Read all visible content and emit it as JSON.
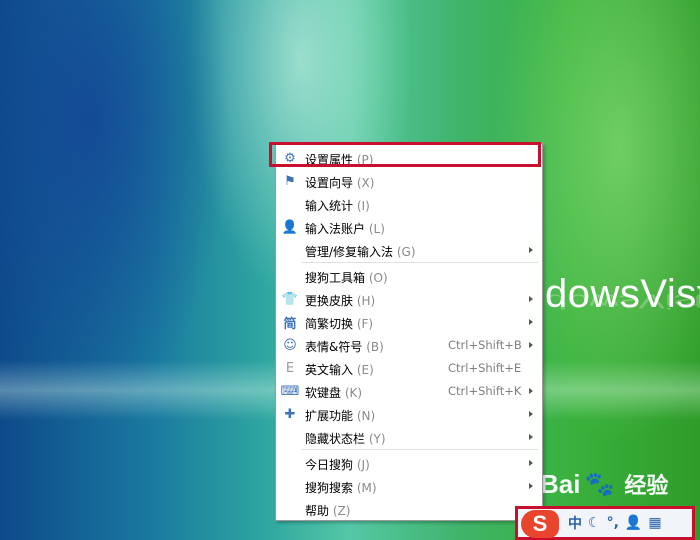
{
  "wallpaper": {
    "text": "dowsVist"
  },
  "watermark": {
    "brand": "Bai",
    "paw": "🐾",
    "suffix": "经验"
  },
  "menu": {
    "items": [
      {
        "label": "设置属性",
        "key": "(P)",
        "icon": "gear-icon",
        "glyph": "⚙",
        "shortcut": "",
        "submenu": false,
        "highlighted": true
      },
      {
        "label": "设置向导",
        "key": "(X)",
        "icon": "flag-icon",
        "glyph": "⚑",
        "shortcut": "",
        "submenu": false
      },
      {
        "label": "输入统计",
        "key": "(I)",
        "icon": "",
        "glyph": "",
        "shortcut": "",
        "submenu": false
      },
      {
        "label": "输入法账户",
        "key": "(L)",
        "icon": "user-icon",
        "glyph": "👤",
        "shortcut": "",
        "submenu": false
      },
      {
        "label": "管理/修复输入法",
        "key": "(G)",
        "icon": "",
        "glyph": "",
        "shortcut": "",
        "submenu": true
      },
      {
        "label": "搜狗工具箱",
        "key": "(O)",
        "icon": "",
        "glyph": "",
        "shortcut": "",
        "submenu": false
      },
      {
        "label": "更换皮肤",
        "key": "(H)",
        "icon": "shirt-icon",
        "glyph": "👕",
        "shortcut": "",
        "submenu": true
      },
      {
        "label": "简繁切换",
        "key": "(F)",
        "icon": "jian-icon",
        "glyph": "简",
        "shortcut": "",
        "submenu": true
      },
      {
        "label": "表情&符号",
        "key": "(B)",
        "icon": "smiley-icon",
        "glyph": "☺",
        "shortcut": "Ctrl+Shift+B",
        "submenu": true
      },
      {
        "label": "英文输入",
        "key": "(E)",
        "icon": "letter-e-icon",
        "glyph": "E",
        "shortcut": "Ctrl+Shift+E",
        "submenu": false
      },
      {
        "label": "软键盘",
        "key": "(K)",
        "icon": "keyboard-icon",
        "glyph": "⌨",
        "shortcut": "Ctrl+Shift+K",
        "submenu": true
      },
      {
        "label": "扩展功能",
        "key": "(N)",
        "icon": "puzzle-icon",
        "glyph": "✚",
        "shortcut": "",
        "submenu": true
      },
      {
        "label": "隐藏状态栏",
        "key": "(Y)",
        "icon": "",
        "glyph": "",
        "shortcut": "",
        "submenu": true
      },
      {
        "label": "今日搜狗",
        "key": "(J)",
        "icon": "",
        "glyph": "",
        "shortcut": "",
        "submenu": true
      },
      {
        "label": "搜狗搜索",
        "key": "(M)",
        "icon": "",
        "glyph": "",
        "shortcut": "",
        "submenu": true
      },
      {
        "label": "帮助",
        "key": "(Z)",
        "icon": "",
        "glyph": "",
        "shortcut": "",
        "submenu": true
      }
    ]
  },
  "statusbar": {
    "logo": "S",
    "icons": [
      {
        "name": "chinese-mode-icon",
        "glyph": "中"
      },
      {
        "name": "moon-icon",
        "glyph": "☾"
      },
      {
        "name": "punctuation-icon",
        "glyph": "°,"
      },
      {
        "name": "user-icon",
        "glyph": "👤"
      },
      {
        "name": "grid-icon",
        "glyph": "▦"
      }
    ]
  },
  "colors": {
    "highlight": "#c8102e",
    "icon": "#3b73b9",
    "logo": "#e8452c"
  }
}
